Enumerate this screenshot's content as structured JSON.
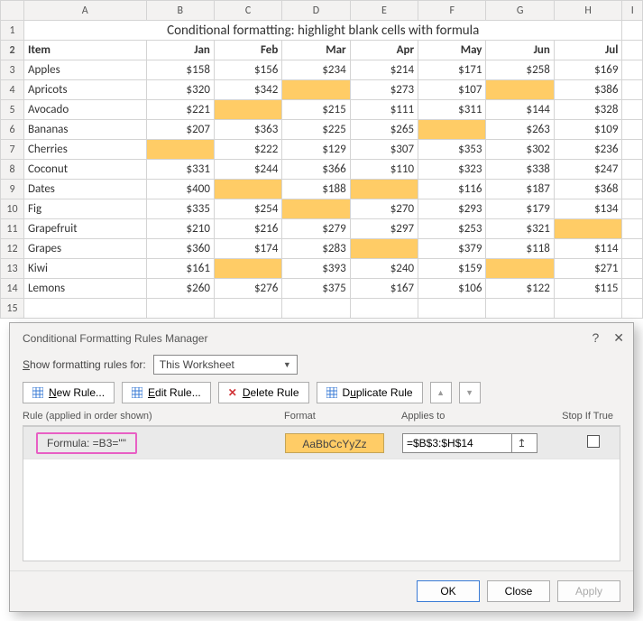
{
  "title": "Conditional formatting: highlight blank cells with formula",
  "columns": [
    "A",
    "B",
    "C",
    "D",
    "E",
    "F",
    "G",
    "H",
    "I"
  ],
  "headers": {
    "item": "Item",
    "months": [
      "Jan",
      "Feb",
      "Mar",
      "Apr",
      "May",
      "Jun",
      "Jul"
    ]
  },
  "rows": [
    {
      "n": 3,
      "item": "Apples",
      "m": [
        "$158",
        "$156",
        "$234",
        "$214",
        "$171",
        "$258",
        "$169"
      ]
    },
    {
      "n": 4,
      "item": "Apricots",
      "m": [
        "$320",
        "$342",
        "",
        "$273",
        "$107",
        "",
        "$386"
      ]
    },
    {
      "n": 5,
      "item": "Avocado",
      "m": [
        "$221",
        "",
        "$215",
        "$111",
        "$311",
        "$144",
        "$328"
      ]
    },
    {
      "n": 6,
      "item": "Bananas",
      "m": [
        "$207",
        "$363",
        "$225",
        "$265",
        "",
        "$263",
        "$109"
      ]
    },
    {
      "n": 7,
      "item": "Cherries",
      "m": [
        "",
        "$222",
        "$129",
        "$307",
        "$353",
        "$302",
        "$236"
      ]
    },
    {
      "n": 8,
      "item": "Coconut",
      "m": [
        "$331",
        "$244",
        "$366",
        "$110",
        "$323",
        "$338",
        "$247"
      ]
    },
    {
      "n": 9,
      "item": "Dates",
      "m": [
        "$400",
        "",
        "$188",
        "",
        "$116",
        "$187",
        "$368"
      ]
    },
    {
      "n": 10,
      "item": "Fig",
      "m": [
        "$335",
        "$254",
        "",
        "$270",
        "$293",
        "$179",
        "$134"
      ]
    },
    {
      "n": 11,
      "item": "Grapefruit",
      "m": [
        "$210",
        "$216",
        "$279",
        "$297",
        "$253",
        "$321",
        ""
      ]
    },
    {
      "n": 12,
      "item": "Grapes",
      "m": [
        "$360",
        "$174",
        "$283",
        "",
        "$379",
        "$118",
        "$114"
      ]
    },
    {
      "n": 13,
      "item": "Kiwi",
      "m": [
        "$161",
        "",
        "$393",
        "$240",
        "$159",
        "",
        "$271"
      ]
    },
    {
      "n": 14,
      "item": "Lemons",
      "m": [
        "$260",
        "$276",
        "$375",
        "$167",
        "$106",
        "$122",
        "$115"
      ]
    }
  ],
  "dialog": {
    "title": "Conditional Formatting Rules Manager",
    "show_label_pre": "S",
    "show_label_rest": "how formatting rules for:",
    "scope": "This Worksheet",
    "buttons": {
      "new_u": "N",
      "new_rest": "ew Rule...",
      "edit_u": "E",
      "edit_rest": "dit Rule...",
      "del_pre": "",
      "del_u": "D",
      "del_rest": "elete Rule",
      "dup_pre": "D",
      "dup_u": "u",
      "dup_rest": "plicate Rule"
    },
    "list_header": {
      "rule": "Rule (applied in order shown)",
      "fmt": "Format",
      "app": "Applies to",
      "stop": "Stop If True"
    },
    "rule_formula": "Formula: =B3=\"\"",
    "rule_sample": "AaBbCcYyZz",
    "rule_applies": "=$B$3:$H$14",
    "footer": {
      "ok": "OK",
      "close": "Close",
      "apply": "Apply"
    }
  },
  "icons": {
    "x": "✕",
    "help": "?",
    "up": "▲",
    "down": "▼",
    "del": "✕",
    "picker": "↥"
  }
}
